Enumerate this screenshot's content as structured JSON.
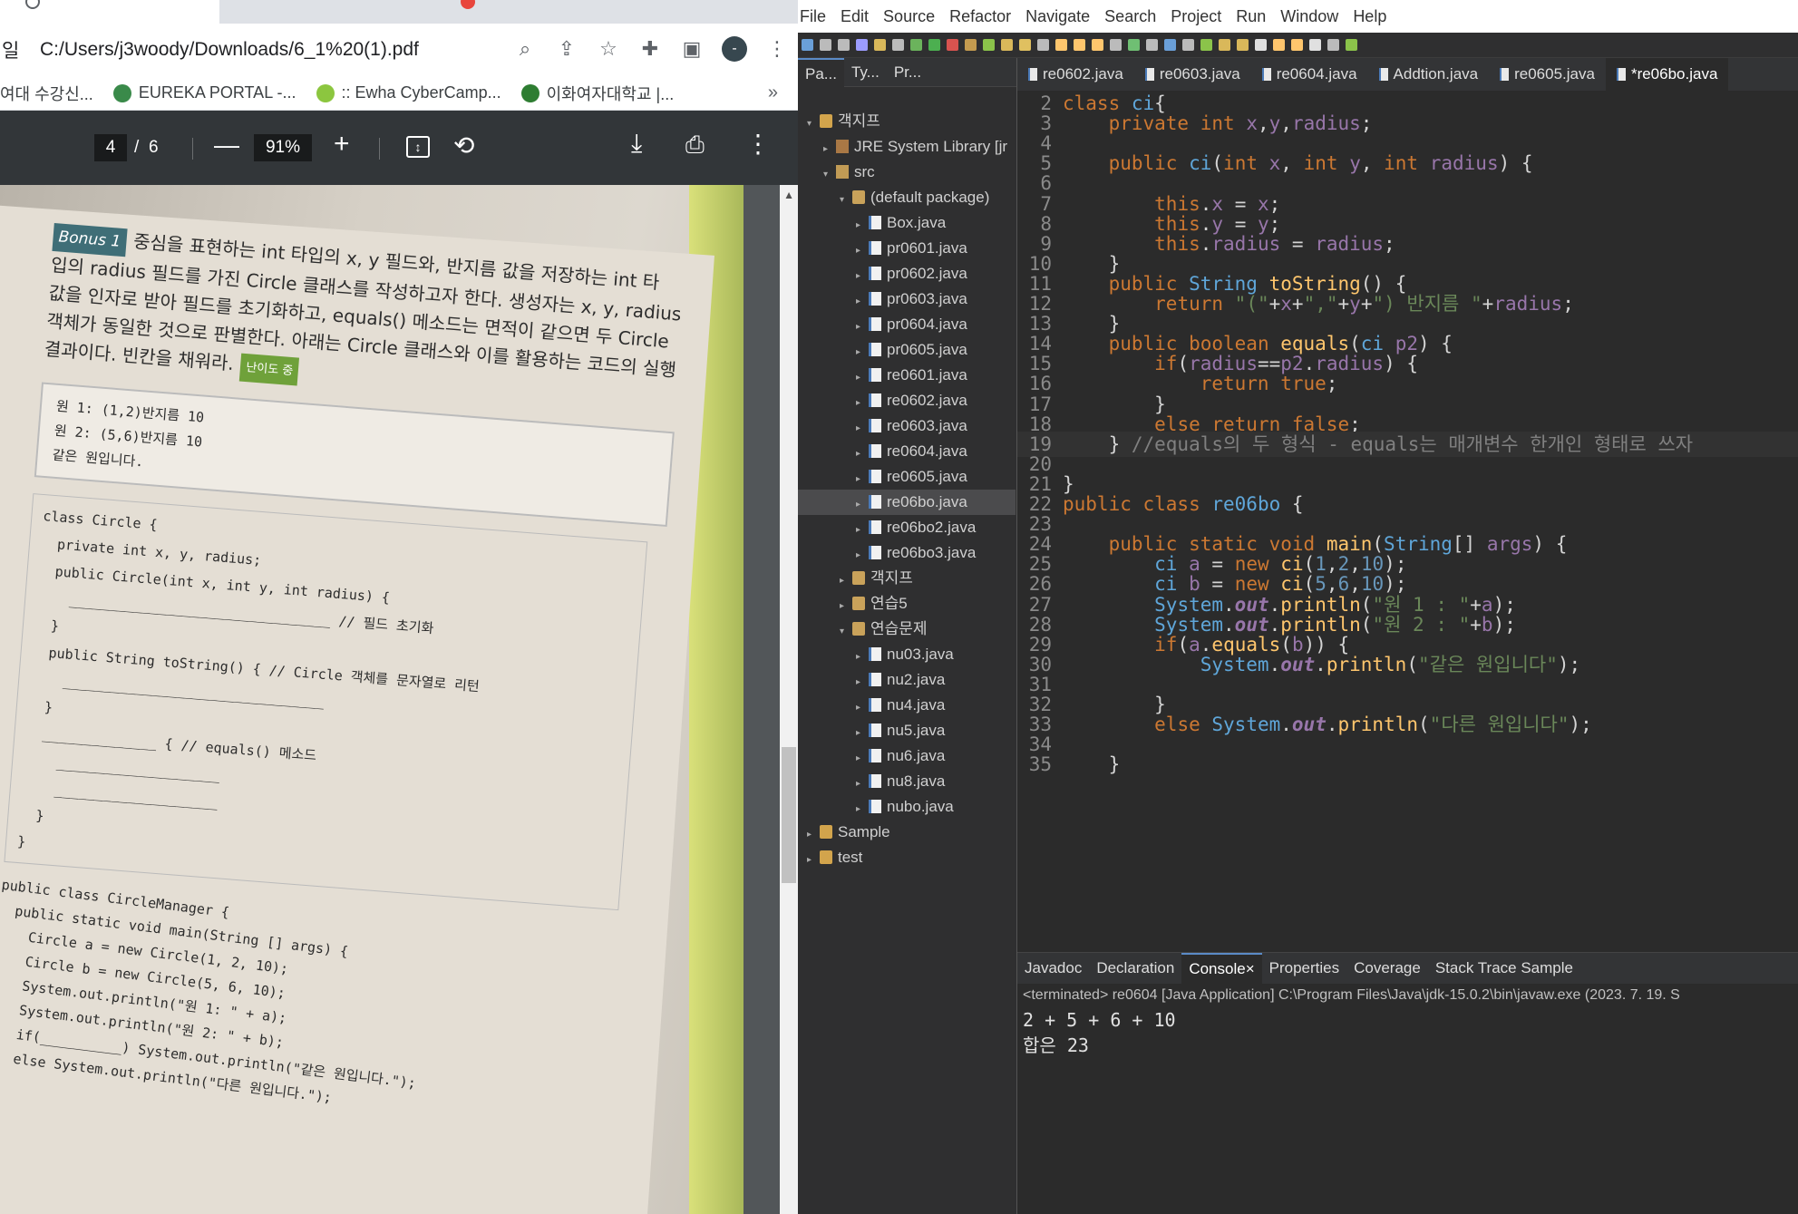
{
  "chrome": {
    "address_prefix": "일",
    "url": "C:/Users/j3woody/Downloads/6_1%20(1).pdf",
    "profile_initial": "-",
    "bookmarks": [
      {
        "label": "여대 수강신...",
        "color": "#ffffff"
      },
      {
        "label": "EUREKA PORTAL -...",
        "color": "#3a8a4a"
      },
      {
        "label": ":: Ewha CyberCamp...",
        "color": "#8cc63f"
      },
      {
        "label": "이화여자대학교 |...",
        "color": "#2e7d32"
      }
    ],
    "bookmarks_more": "»"
  },
  "pdf_viewer": {
    "current_page": "4",
    "page_separator": "/",
    "total_pages": "6",
    "zoom": "91%",
    "book_page": {
      "bonus_label": "Bonus 1",
      "problem_text_lines": [
        "중심을 표현하는 int 타입의 x, y 필드와, 반지름 값을 저장하는 int 타",
        "입의 radius 필드를 가진 Circle 클래스를 작성하고자 한다. 생성자는 x, y, radius",
        "값을 인자로 받아 필드를 초기화하고, equals() 메소드는 면적이 같으면 두 Circle",
        "객체가 동일한 것으로 판별한다. 아래는 Circle 클래스와 이를 활용하는 코드의 실행",
        "결과이다. 빈칸을 채워라."
      ],
      "level_label": "난이도 중",
      "output_lines": [
        "원 1: (1,2)반지름 10",
        "원 2: (5,6)반지름 10",
        "같은 원입니다."
      ],
      "code_lines_1": [
        "class Circle {",
        "  private int x, y, radius;",
        "  public Circle(int x, int y, int radius) {",
        "    ________________________________ // 필드 초기화",
        "  }",
        "  public String toString() { // Circle 객체를 문자열로 리턴",
        "    ________________________________",
        "  }",
        "  ______________ { // equals() 메소드",
        "    ____________________",
        "    ____________________",
        "  }",
        "}"
      ],
      "code_lines_2": [
        "public class CircleManager {",
        "  public static void main(String [] args) {",
        "    Circle a = new Circle(1, 2, 10);",
        "    Circle b = new Circle(5, 6, 10);",
        "    System.out.println(\"원 1: \" + a);",
        "    System.out.println(\"원 2: \" + b);",
        "    if(__________) System.out.println(\"같은 원입니다.\");",
        "    else System.out.println(\"다른 원입니다.\");",
        "}"
      ]
    }
  },
  "eclipse": {
    "menu": [
      "File",
      "Edit",
      "Source",
      "Refactor",
      "Navigate",
      "Search",
      "Project",
      "Run",
      "Window",
      "Help"
    ],
    "explorer_tabs": [
      "Pa...",
      "Ty...",
      "Pr..."
    ],
    "tree": [
      {
        "label": "객지프",
        "indent": 0,
        "icon": "proj",
        "twisty": "▾"
      },
      {
        "label": "JRE System Library [jr",
        "indent": 1,
        "icon": "lib",
        "twisty": "▸"
      },
      {
        "label": "src",
        "indent": 1,
        "icon": "src",
        "twisty": "▾"
      },
      {
        "label": "(default package)",
        "indent": 2,
        "icon": "pkg",
        "twisty": "▾"
      },
      {
        "label": "Box.java",
        "indent": 3,
        "icon": "java",
        "twisty": "▸"
      },
      {
        "label": "pr0601.java",
        "indent": 3,
        "icon": "java",
        "twisty": "▸"
      },
      {
        "label": "pr0602.java",
        "indent": 3,
        "icon": "java",
        "twisty": "▸"
      },
      {
        "label": "pr0603.java",
        "indent": 3,
        "icon": "java",
        "twisty": "▸"
      },
      {
        "label": "pr0604.java",
        "indent": 3,
        "icon": "java",
        "twisty": "▸"
      },
      {
        "label": "pr0605.java",
        "indent": 3,
        "icon": "java",
        "twisty": "▸"
      },
      {
        "label": "re0601.java",
        "indent": 3,
        "icon": "java",
        "twisty": "▸"
      },
      {
        "label": "re0602.java",
        "indent": 3,
        "icon": "java",
        "twisty": "▸"
      },
      {
        "label": "re0603.java",
        "indent": 3,
        "icon": "java",
        "twisty": "▸"
      },
      {
        "label": "re0604.java",
        "indent": 3,
        "icon": "java",
        "twisty": "▸"
      },
      {
        "label": "re0605.java",
        "indent": 3,
        "icon": "java",
        "twisty": "▸"
      },
      {
        "label": "re06bo.java",
        "indent": 3,
        "icon": "java",
        "twisty": "▸",
        "selected": true
      },
      {
        "label": "re06bo2.java",
        "indent": 3,
        "icon": "java",
        "twisty": "▸"
      },
      {
        "label": "re06bo3.java",
        "indent": 3,
        "icon": "java",
        "twisty": "▸"
      },
      {
        "label": "객지프",
        "indent": 2,
        "icon": "pkg",
        "twisty": "▸"
      },
      {
        "label": "연습5",
        "indent": 2,
        "icon": "pkg",
        "twisty": "▸"
      },
      {
        "label": "연습문제",
        "indent": 2,
        "icon": "pkg",
        "twisty": "▾"
      },
      {
        "label": "nu03.java",
        "indent": 3,
        "icon": "java",
        "twisty": "▸"
      },
      {
        "label": "nu2.java",
        "indent": 3,
        "icon": "java",
        "twisty": "▸"
      },
      {
        "label": "nu4.java",
        "indent": 3,
        "icon": "java",
        "twisty": "▸"
      },
      {
        "label": "nu5.java",
        "indent": 3,
        "icon": "java",
        "twisty": "▸"
      },
      {
        "label": "nu6.java",
        "indent": 3,
        "icon": "java",
        "twisty": "▸"
      },
      {
        "label": "nu8.java",
        "indent": 3,
        "icon": "java",
        "twisty": "▸"
      },
      {
        "label": "nubo.java",
        "indent": 3,
        "icon": "java",
        "twisty": "▸"
      },
      {
        "label": "Sample",
        "indent": 0,
        "icon": "proj",
        "twisty": "▸"
      },
      {
        "label": "test",
        "indent": 0,
        "icon": "proj",
        "twisty": "▸"
      }
    ],
    "editor_tabs": [
      "re0602.java",
      "re0603.java",
      "re0604.java",
      "Addtion.java",
      "re0605.java",
      "*re06bo.java"
    ],
    "active_editor_tab": "*re06bo.java",
    "code_lines": [
      {
        "n": "2",
        "html": "<span class='c-kw'>class</span> <span class='c-cls'>ci</span>{"
      },
      {
        "n": "3",
        "html": "    <span class='c-kw'>private int</span> <span class='c-fld'>x</span>,<span class='c-fld'>y</span>,<span class='c-fld'>radius</span>;"
      },
      {
        "n": "4",
        "html": ""
      },
      {
        "n": "5",
        "html": "    <span class='c-kw'>public</span> <span class='c-cls'>ci</span>(<span class='c-kw'>int</span> <span class='c-fld'>x</span>, <span class='c-kw'>int</span> <span class='c-fld'>y</span>, <span class='c-kw'>int</span> <span class='c-fld'>radius</span>) {"
      },
      {
        "n": "6",
        "html": ""
      },
      {
        "n": "7",
        "html": "        <span class='c-kw'>this</span>.<span class='c-fld'>x</span> = <span class='c-fld'>x</span>;"
      },
      {
        "n": "8",
        "html": "        <span class='c-kw'>this</span>.<span class='c-fld'>y</span> = <span class='c-fld'>y</span>;"
      },
      {
        "n": "9",
        "html": "        <span class='c-kw'>this</span>.<span class='c-fld'>radius</span> = <span class='c-fld'>radius</span>;"
      },
      {
        "n": "10",
        "html": "    }"
      },
      {
        "n": "11",
        "html": "    <span class='c-kw'>public</span> <span class='c-cls'>String</span> <span class='c-meth'>toString</span>() {"
      },
      {
        "n": "12",
        "html": "        <span class='c-kw'>return</span> <span class='c-str'>\"(\"</span>+<span class='c-fld'>x</span>+<span class='c-str'>\",\"</span>+<span class='c-fld'>y</span>+<span class='c-str'>\") 반지름 \"</span>+<span class='c-fld'>radius</span>;"
      },
      {
        "n": "13",
        "html": "    }"
      },
      {
        "n": "14",
        "html": "    <span class='c-kw'>public boolean</span> <span class='c-meth'>equals</span>(<span class='c-cls'>ci</span> <span class='c-fld'>p2</span>) {"
      },
      {
        "n": "15",
        "html": "        <span class='c-kw'>if</span>(<span class='c-fld'>radius</span>==<span class='c-fld'>p2</span>.<span class='c-fld'>radius</span>) {"
      },
      {
        "n": "16",
        "html": "            <span class='c-kw'>return true</span>;"
      },
      {
        "n": "17",
        "html": "        }"
      },
      {
        "n": "18",
        "html": "        <span class='c-kw'>else return false</span>;"
      },
      {
        "n": "19",
        "html": "    } <span class='c-cmt'>//equals의 두 형식 - equals는 매개변수 한개인 형태로 쓰자</span>"
      },
      {
        "n": "20",
        "html": ""
      },
      {
        "n": "21",
        "html": "}"
      },
      {
        "n": "22",
        "html": "<span class='c-kw'>public class</span> <span class='c-cls'>re06bo</span> {"
      },
      {
        "n": "23",
        "html": ""
      },
      {
        "n": "24",
        "html": "    <span class='c-kw'>public static void</span> <span class='c-meth'>main</span>(<span class='c-cls'>String</span>[] <span class='c-fld'>args</span>) {"
      },
      {
        "n": "25",
        "html": "        <span class='c-cls'>ci</span> <span class='c-fld'>a</span> = <span class='c-kw'>new</span> <span class='c-meth'>ci</span>(<span class='c-num'>1</span>,<span class='c-num'>2</span>,<span class='c-num'>10</span>);"
      },
      {
        "n": "26",
        "html": "        <span class='c-cls'>ci</span> <span class='c-fld'>b</span> = <span class='c-kw'>new</span> <span class='c-meth'>ci</span>(<span class='c-num'>5</span>,<span class='c-num'>6</span>,<span class='c-num'>10</span>);"
      },
      {
        "n": "27",
        "html": "        <span class='c-cls'>System</span>.<span class='c-static'>out</span>.<span class='c-meth'>println</span>(<span class='c-str'>\"원 1 : \"</span>+<span class='c-fld'>a</span>);"
      },
      {
        "n": "28",
        "html": "        <span class='c-cls'>System</span>.<span class='c-static'>out</span>.<span class='c-meth'>println</span>(<span class='c-str'>\"원 2 : \"</span>+<span class='c-fld'>b</span>);"
      },
      {
        "n": "29",
        "html": "        <span class='c-kw'>if</span>(<span class='c-fld'>a</span>.<span class='c-meth'>equals</span>(<span class='c-fld'>b</span>)) {"
      },
      {
        "n": "30",
        "html": "            <span class='c-cls'>System</span>.<span class='c-static'>out</span>.<span class='c-meth'>println</span>(<span class='c-str'>\"같은 원입니다\"</span>);"
      },
      {
        "n": "31",
        "html": ""
      },
      {
        "n": "32",
        "html": "        }"
      },
      {
        "n": "33",
        "html": "        <span class='c-kw'>else</span> <span class='c-cls'>System</span>.<span class='c-static'>out</span>.<span class='c-meth'>println</span>(<span class='c-str'>\"다른 원입니다\"</span>);"
      },
      {
        "n": "34",
        "html": ""
      },
      {
        "n": "35",
        "html": "    }"
      }
    ],
    "bottom_tabs": [
      "Javadoc",
      "Declaration",
      "Console",
      "Properties",
      "Coverage",
      "Stack Trace Sample"
    ],
    "active_bottom_tab": "Console",
    "console_terminated": "<terminated> re0604 [Java Application] C:\\Program Files\\Java\\jdk-15.0.2\\bin\\javaw.exe (2023. 7. 19. S",
    "console_output": [
      "2 + 5 + 6 + 10",
      "합은 23"
    ]
  }
}
